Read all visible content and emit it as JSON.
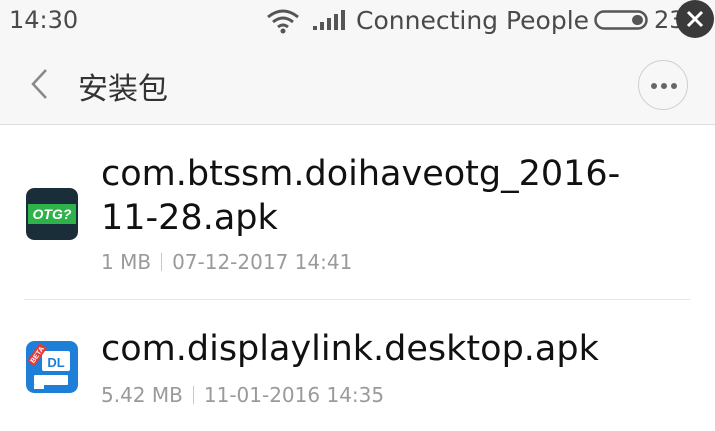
{
  "status_bar": {
    "time": "14:30",
    "carrier": "Connecting People",
    "battery_pct": "23"
  },
  "header": {
    "title": "安装包"
  },
  "files": [
    {
      "name": "com.btssm.doihaveotg_2016-11-28.apk",
      "size": "1 MB",
      "date": "07-12-2017 14:41",
      "icon_label": "OTG?",
      "icon": "otg-app-icon"
    },
    {
      "name": "com.displaylink.desktop.apk",
      "size": "5.42 MB",
      "date": "11-01-2016 14:35",
      "icon_label": "DL",
      "icon_badge": "BETA",
      "icon": "displaylink-app-icon"
    }
  ],
  "colors": {
    "otg_icon_bg": "#1a2e3a",
    "otg_icon_text": "#2eb24a",
    "dl_icon_bg": "#1e7fd8"
  }
}
